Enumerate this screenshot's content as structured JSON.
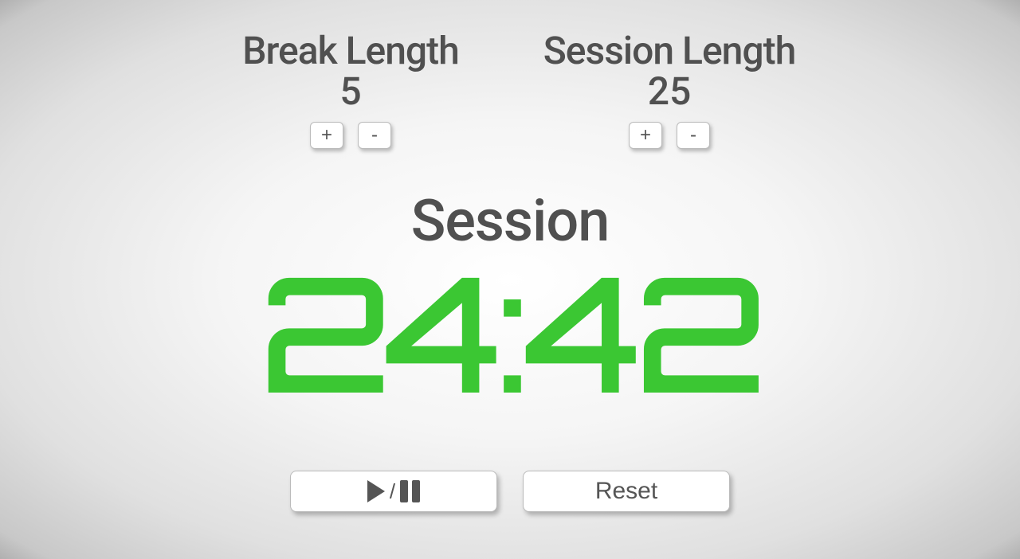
{
  "break": {
    "label": "Break Length",
    "value": "5",
    "plus": "+",
    "minus": "-"
  },
  "session": {
    "label": "Session Length",
    "value": "25",
    "plus": "+",
    "minus": "-"
  },
  "timer": {
    "label": "Session",
    "time_left": "24:42"
  },
  "controls": {
    "play_pause_separator": "/",
    "reset": "Reset"
  }
}
